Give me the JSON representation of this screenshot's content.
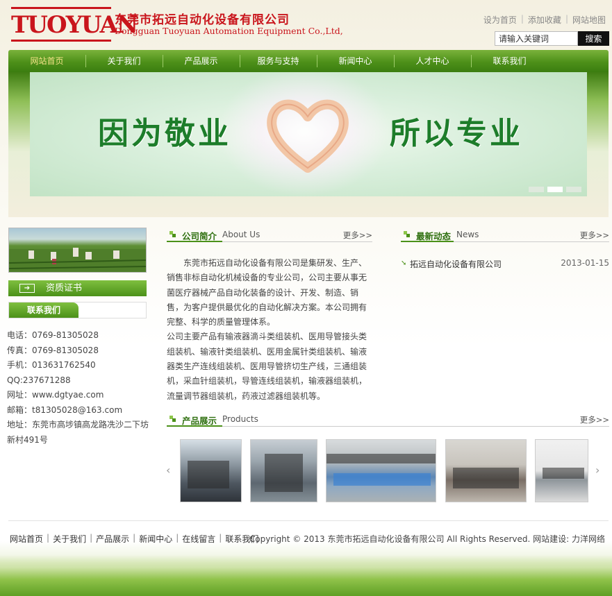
{
  "header": {
    "logo_text": "TUOYUAN",
    "company_cn": "东莞市拓远自动化设备有限公司",
    "company_en": "Dongguan Tuoyuan Automation Equipment Co.,Ltd,",
    "top_links": [
      "设为首页",
      "添加收藏",
      "网站地图"
    ],
    "search_placeholder": "请输入关键词",
    "search_value": "请输入关键词",
    "search_button": "搜索"
  },
  "nav": {
    "items": [
      "网站首页",
      "关于我们",
      "产品展示",
      "服务与支持",
      "新闻中心",
      "人才中心",
      "联系我们"
    ]
  },
  "banner": {
    "left_text": "因为敬业",
    "right_text": "所以专业"
  },
  "sidebar": {
    "cert_label": "资质证书",
    "contact_tab": "联系我们",
    "contact_lines": [
      "电话：0769-81305028",
      "传真：0769-81305028",
      "手机：013631762540  QQ:237671288",
      "网址：www.dgtyae.com",
      "邮箱：t81305028@163.com",
      "地址：东莞市高埗镇高龙路冼沙二下坊新村491号"
    ]
  },
  "about": {
    "title_cn": "公司简介",
    "title_en": "About Us",
    "more": "更多>>",
    "para1": "东莞市拓远自动化设备有限公司是集研发、生产、销售非标自动化机械设备的专业公司，公司主要从事无菌医疗器械产品自动化装备的设计、开发、制造、销售，为客户提供最优化的自动化解决方案。本公司拥有完整、科学的质量管理体系。",
    "para2": "公司主要产品有输液器滴斗类组装机、医用导管接头类组装机、输液针类组装机、医用金属针类组装机、输液器类生产连线组装机、医用导管挤切生产线，三通组装机，采血针组装机，导管连线组装机，输液器组装机，流量调节器组装机，药液过滤器组装机等。"
  },
  "news": {
    "title_cn": "最新动态",
    "title_en": "News",
    "more": "更多>>",
    "items": [
      {
        "title": "拓远自动化设备有限公司",
        "date": "2013-01-15"
      }
    ]
  },
  "products": {
    "title_cn": "产品展示",
    "title_en": "Products",
    "more": "更多>>",
    "prev": "‹",
    "next": "›"
  },
  "footer": {
    "links": [
      "网站首页",
      "关于我们",
      "产品展示",
      "新闻中心",
      "在线留言",
      "联系我们"
    ],
    "copyright": "Copyright © 2013 东莞市拓远自动化设备有限公司  All Rights Reserved.  网站建设: 力洋网络"
  }
}
